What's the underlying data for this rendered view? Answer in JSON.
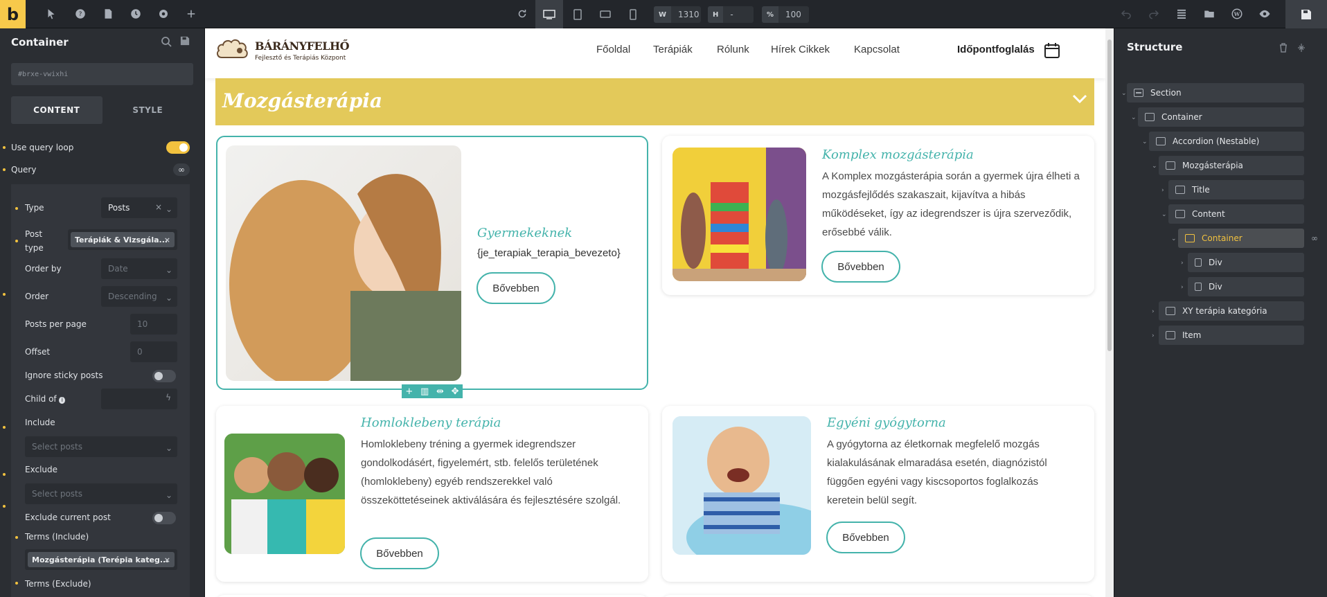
{
  "topbar": {
    "logo": "b",
    "width_label": "W",
    "width_value": "1310",
    "height_label": "H",
    "height_value": "-",
    "zoom_label": "%",
    "zoom_value": "100"
  },
  "left": {
    "title": "Container",
    "css_id": "#brxe-vwixhi",
    "tabs": [
      "CONTENT",
      "STYLE"
    ],
    "use_query_loop": "Use query loop",
    "query": "Query",
    "q": {
      "type_label": "Type",
      "type_value": "Posts",
      "post_type_label": "Post\ntype",
      "post_type_tag": "Terápiák & Vizsgála...",
      "order_by_label": "Order by",
      "order_by_value": "Date",
      "order_label": "Order",
      "order_value": "Descending",
      "ppp_label": "Posts per page",
      "ppp_value": "10",
      "offset_label": "Offset",
      "offset_value": "0",
      "sticky_label": "Ignore sticky posts",
      "child_label": "Child of",
      "include_label": "Include",
      "include_placeholder": "Select posts",
      "exclude_label": "Exclude",
      "exclude_placeholder": "Select posts",
      "exclude_current_label": "Exclude current post",
      "terms_include_label": "Terms (Include)",
      "terms_tag": "Mozgásterápia (Terépia kateg...",
      "terms_exclude_label": "Terms (Exclude)"
    }
  },
  "site": {
    "logo_name": "BÁRÁNYFELHŐ",
    "logo_sub": "Fejlesztő és Terápiás Központ",
    "nav": [
      "Főoldal",
      "Terápiák",
      "Rólunk",
      "Hírek Cikkek",
      "Kapcsolat"
    ],
    "cta": "Időpontfoglalás",
    "accordion_title": "Mozgásterápia",
    "cards": [
      {
        "title": "Gyermekeknek",
        "text": "{je_terapiak_terapia_bevezeto}",
        "button": "Bővebben"
      },
      {
        "title": "Komplex mozgásterápia",
        "text": "A Komplex mozgásterápia során a gyermek újra élheti a mozgásfejlődés szakaszait, kijavítva a hibás működéseket, így az idegrendszer is újra szerveződik, erősebbé válik.",
        "button": "Bővebben"
      },
      {
        "title": "Homloklebeny terápia",
        "text": "Homloklebeny tréning a gyermek idegrendszer gondolkodásért, figyelemért, stb. felelős területének (homloklebeny) egyéb rendszerekkel való összeköttetéseinek aktiválására és fejlesztésére szolgál.",
        "button": "Bővebben"
      },
      {
        "title": "Egyéni gyógytorna",
        "text": "A gyógytorna az életkornak megfelelő mozgás kialakulásának elmaradása esetén, diagnózistól függően egyéni vagy kiscsoportos foglalkozás keretein belül segít.",
        "button": "Bővebben"
      }
    ]
  },
  "structure": {
    "title": "Structure",
    "nodes": [
      "Section",
      "Container",
      "Accordion (Nestable)",
      "Mozgásterápia",
      "Title",
      "Content",
      "Container",
      "Div",
      "Div",
      "XY terápia kategória",
      "Item"
    ]
  },
  "colors": {
    "accent": "#f2c23f",
    "teal": "#44b3ab",
    "banner": "#e3c95a"
  }
}
